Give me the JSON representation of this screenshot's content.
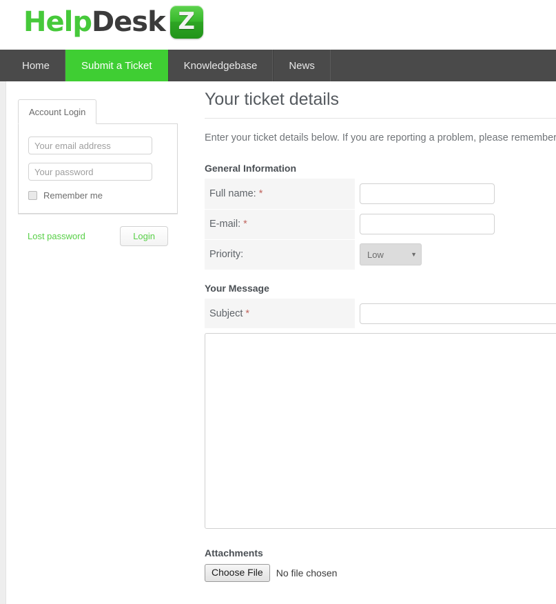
{
  "brand": {
    "logo_part1": "Help",
    "logo_part2": "Desk",
    "logo_badge": "Z",
    "accent_green": "#3fce33",
    "nav_bg": "#4a4a4a",
    "link_green": "#57cf46",
    "required_red": "#c0665f"
  },
  "nav": {
    "items": [
      {
        "label": "Home",
        "active": false
      },
      {
        "label": "Submit a Ticket",
        "active": true
      },
      {
        "label": "Knowledgebase",
        "active": false
      },
      {
        "label": "News",
        "active": false
      }
    ]
  },
  "sidebar": {
    "tab_label": "Account Login",
    "email": {
      "value": "",
      "placeholder": "Your email address"
    },
    "password": {
      "value": "",
      "placeholder": "Your password"
    },
    "remember": {
      "label": "Remember me",
      "checked": false
    },
    "lost_password_label": "Lost password",
    "login_button_label": "Login"
  },
  "main": {
    "title": "Your ticket details",
    "intro": "Enter your ticket details below. If you are reporting a problem, please remember t",
    "general_section": {
      "heading": "General Information",
      "rows": [
        {
          "label": "Full name:",
          "required": "*",
          "value": "",
          "type": "text"
        },
        {
          "label": "E-mail:",
          "required": "*",
          "value": "",
          "type": "text"
        },
        {
          "label": "Priority:",
          "required": "",
          "value": "Low",
          "type": "select",
          "caret": "▼"
        }
      ]
    },
    "message_section": {
      "heading": "Your Message",
      "subject_label": "Subject",
      "subject_required": "*",
      "subject_value": "",
      "body_value": ""
    },
    "attachments_section": {
      "heading": "Attachments",
      "choose_button_label": "Choose File",
      "file_status": "No file chosen"
    }
  }
}
